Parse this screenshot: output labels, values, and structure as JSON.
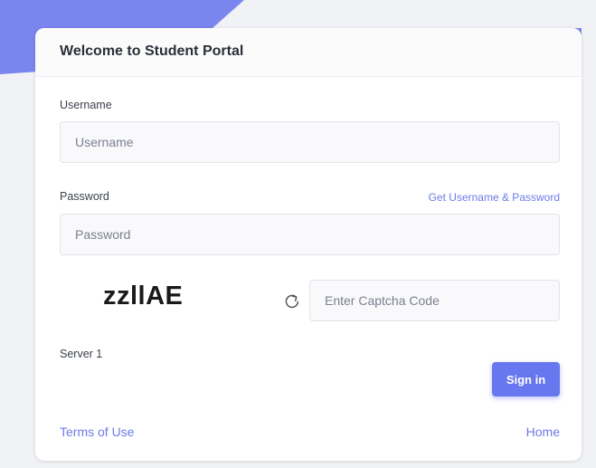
{
  "portal": {
    "title": "Welcome to Student Portal"
  },
  "username": {
    "label": "Username",
    "placeholder": "Username",
    "value": ""
  },
  "password": {
    "label": "Password",
    "placeholder": "Password",
    "value": "",
    "help_link": "Get Username & Password"
  },
  "captcha": {
    "code": "zzllAE",
    "placeholder": "Enter Captcha Code",
    "value": "",
    "refresh_icon": "refresh-icon"
  },
  "server": {
    "label": "Server 1"
  },
  "actions": {
    "signin_label": "Sign in"
  },
  "footer": {
    "terms_label": "Terms of Use",
    "home_label": "Home"
  },
  "colors": {
    "accent": "#6777ef",
    "link": "#6c7bea",
    "background": "#f1f2f5"
  }
}
